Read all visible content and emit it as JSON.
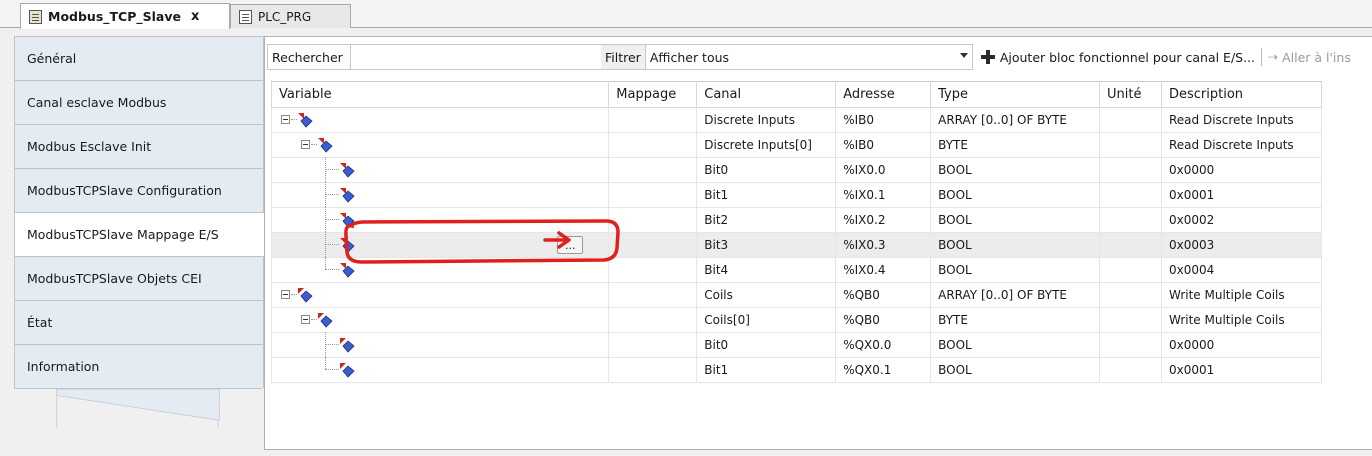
{
  "tabs": [
    {
      "label": "Modbus_TCP_Slave",
      "close": "x",
      "icon": "device-icon"
    },
    {
      "label": "PLC_PRG",
      "icon": "document-icon"
    }
  ],
  "sidebar": {
    "items": [
      {
        "label": "Général"
      },
      {
        "label": "Canal esclave Modbus"
      },
      {
        "label": "Modbus Esclave Init"
      },
      {
        "label": "ModbusTCPSlave Configuration"
      },
      {
        "label": "ModbusTCPSlave Mappage E/S"
      },
      {
        "label": "ModbusTCPSlave Objets CEI"
      },
      {
        "label": "État"
      },
      {
        "label": "Information"
      }
    ],
    "active_index": 4
  },
  "toolbar": {
    "search_label": "Rechercher",
    "filter_label": "Filtrer",
    "filter_value": "Afficher tous",
    "add_fb_label": "Ajouter bloc fonctionnel pour canal E/S...",
    "goto_label": "Aller à l'ins"
  },
  "grid": {
    "columns": [
      "Variable",
      "Mappage",
      "Canal",
      "Adresse",
      "Type",
      "Unité",
      "Description"
    ],
    "rows": [
      {
        "level": 0,
        "expander": true,
        "dir": "in",
        "canal": "Discrete Inputs",
        "adresse": "%IB0",
        "type": "ARRAY [0..0] OF BYTE",
        "description": "Read Discrete Inputs"
      },
      {
        "level": 1,
        "expander": true,
        "dir": "in",
        "canal": "Discrete Inputs[0]",
        "adresse": "%IB0",
        "type": "BYTE",
        "description": "Read Discrete Inputs"
      },
      {
        "level": 2,
        "expander": false,
        "dir": "in",
        "canal": "Bit0",
        "adresse": "%IX0.0",
        "type": "BOOL",
        "description": "0x0000"
      },
      {
        "level": 2,
        "expander": false,
        "dir": "in",
        "canal": "Bit1",
        "adresse": "%IX0.1",
        "type": "BOOL",
        "description": "0x0001"
      },
      {
        "level": 2,
        "expander": false,
        "dir": "in",
        "canal": "Bit2",
        "adresse": "%IX0.2",
        "type": "BOOL",
        "description": "0x0002"
      },
      {
        "level": 2,
        "expander": false,
        "dir": "in",
        "canal": "Bit3",
        "adresse": "%IX0.3",
        "type": "BOOL",
        "description": "0x0003",
        "selected": true,
        "button": "..."
      },
      {
        "level": 2,
        "expander": false,
        "dir": "in",
        "canal": "Bit4",
        "adresse": "%IX0.4",
        "type": "BOOL",
        "description": "0x0004"
      },
      {
        "level": 0,
        "expander": true,
        "dir": "out",
        "canal": "Coils",
        "adresse": "%QB0",
        "type": "ARRAY [0..0] OF BYTE",
        "description": "Write Multiple Coils"
      },
      {
        "level": 1,
        "expander": true,
        "dir": "out",
        "canal": "Coils[0]",
        "adresse": "%QB0",
        "type": "BYTE",
        "description": "Write Multiple Coils"
      },
      {
        "level": 2,
        "expander": false,
        "dir": "out",
        "canal": "Bit0",
        "adresse": "%QX0.0",
        "type": "BOOL",
        "description": "0x0000"
      },
      {
        "level": 2,
        "expander": false,
        "dir": "out",
        "canal": "Bit1",
        "adresse": "%QX0.1",
        "type": "BOOL",
        "description": "0x0001"
      }
    ]
  },
  "colors": {
    "annotation": "#e0201c",
    "sidebar_bg": "#e4ebf3",
    "selected_row": "#ececec"
  }
}
